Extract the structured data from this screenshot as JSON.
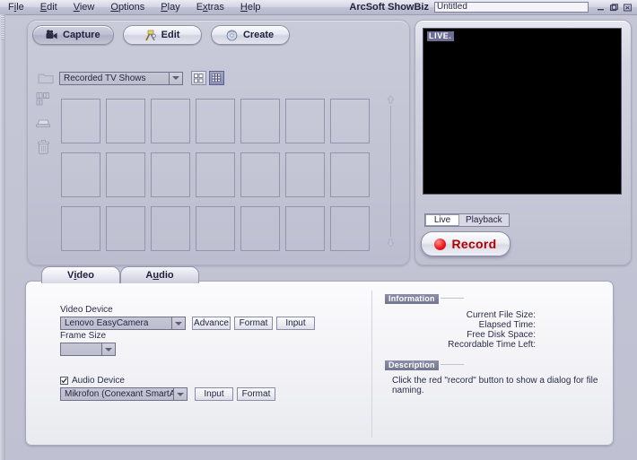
{
  "window": {
    "app_title": "ArcSoft ShowBiz",
    "project_name": "Untitled",
    "project_placeholder": "Untitled",
    "minimize": "minimize-icon",
    "maximize": "maximize-icon",
    "close": "close-icon"
  },
  "menu": {
    "items": [
      {
        "pre": "F",
        "mnemonic": "i",
        "post": "le"
      },
      {
        "pre": "",
        "mnemonic": "E",
        "post": "dit"
      },
      {
        "pre": "",
        "mnemonic": "V",
        "post": "iew"
      },
      {
        "pre": "",
        "mnemonic": "O",
        "post": "ptions"
      },
      {
        "pre": "",
        "mnemonic": "P",
        "post": "lay"
      },
      {
        "pre": "E",
        "mnemonic": "x",
        "post": "tras"
      },
      {
        "pre": "",
        "mnemonic": "H",
        "post": "elp"
      }
    ]
  },
  "modes": {
    "tabs": [
      {
        "label": "Capture",
        "icon": "camcorder-icon",
        "active": true
      },
      {
        "label": "Edit",
        "icon": "edit-tools-icon",
        "active": false
      },
      {
        "label": "Create",
        "icon": "disc-icon",
        "active": false
      }
    ]
  },
  "library": {
    "folder_icon": "folder-icon",
    "album_selected": "Recorded TV Shows",
    "album_options": [
      "Recorded TV Shows"
    ],
    "view_large_icon": "grid-large-icon",
    "view_small_icon": "grid-small-icon",
    "view_mode": "small",
    "rail_icons": [
      "sort-icon",
      "scanner-icon",
      "trash-icon"
    ],
    "thumb_count": 21,
    "scroll_up_icon": "scroll-up-icon",
    "scroll_down_icon": "scroll-down-icon"
  },
  "preview": {
    "live_badge": "LIVE.",
    "source_tabs": [
      {
        "label": "Live",
        "active": true
      },
      {
        "label": "Playback",
        "active": false
      }
    ],
    "record_label": "Record",
    "record_dot_color": "#ee1c1c",
    "record_text_color": "#b00000"
  },
  "settings": {
    "tabs": [
      {
        "pre": "V",
        "mnemonic": "i",
        "post": "deo",
        "active": true
      },
      {
        "pre": "A",
        "mnemonic": "u",
        "post": "dio",
        "active": false
      }
    ],
    "video_device_label": "Video Device",
    "video_device_value": "Lenovo EasyCamera",
    "video_buttons": [
      "Advance",
      "Format",
      "Input"
    ],
    "frame_size_label": "Frame Size",
    "frame_size_value": "",
    "audio_device_label": "Audio Device",
    "audio_device_checked": true,
    "audio_device_value": "Mikrofon (Conexant SmartAudio H",
    "audio_buttons": [
      "Input",
      "Format"
    ]
  },
  "information": {
    "title": "Information",
    "rows": [
      {
        "label": "Current File Size:",
        "value": ""
      },
      {
        "label": "Elapsed Time:",
        "value": ""
      },
      {
        "label": "Free Disk Space:",
        "value": ""
      },
      {
        "label": "Recordable Time Left:",
        "value": ""
      }
    ]
  },
  "description": {
    "title": "Description",
    "text": "Click the red \"record\" button to show a dialog for file naming."
  }
}
